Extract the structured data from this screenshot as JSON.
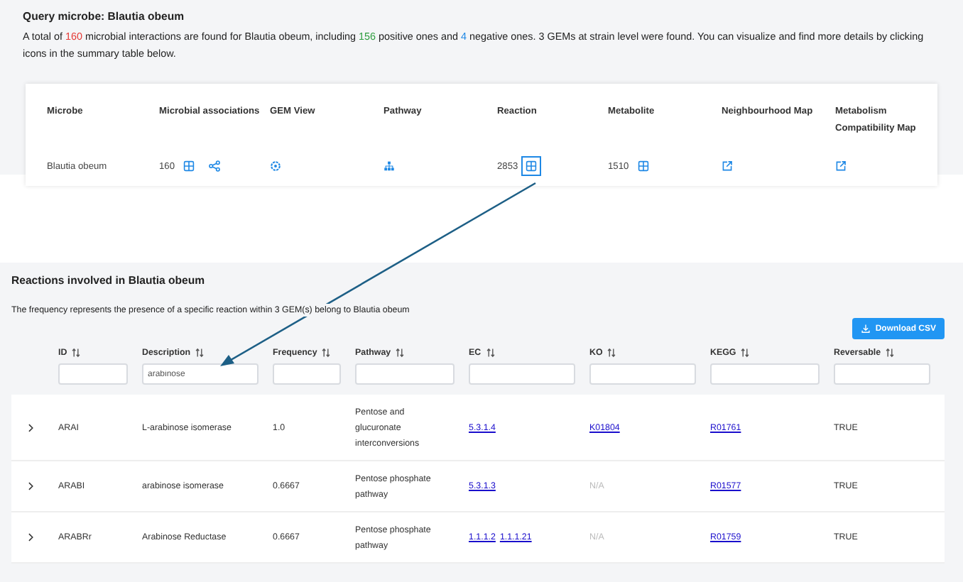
{
  "query": {
    "title": "Query microbe: Blautia obeum",
    "summary": [
      {
        "kind": "text",
        "text": "A total of "
      },
      {
        "kind": "total",
        "text": "160"
      },
      {
        "kind": "text",
        "text": " microbial interactions are found for Blautia obeum, including "
      },
      {
        "kind": "positive",
        "text": "156"
      },
      {
        "kind": "text",
        "text": " positive ones and "
      },
      {
        "kind": "negative",
        "text": "4"
      },
      {
        "kind": "text",
        "text": " negative ones. 3 GEMs at strain level were found. You can visualize and find more details by clicking icons in the summary table below."
      }
    ]
  },
  "summary_table": {
    "columns": [
      "Microbe",
      "Microbial associations",
      "GEM View",
      "Pathway",
      "Reaction",
      "Metabolite",
      "Neighbourhood Map",
      "Metabolism Compatibility Map"
    ],
    "row": {
      "microbe": "Blautia obeum",
      "associations": "160",
      "reaction": "2853",
      "reaction_highlighted": true,
      "metabolite": "1510"
    }
  },
  "reactions": {
    "title": "Reactions involved in Blautia obeum",
    "note": "The frequency represents the presence of a specific reaction within 3 GEM(s) belong to Blautia obeum",
    "download_button": "Download CSV",
    "columns": [
      {
        "label": "ID"
      },
      {
        "label": "Description",
        "filter": "arabinose"
      },
      {
        "label": "Frequency"
      },
      {
        "label": "Pathway"
      },
      {
        "label": "EC"
      },
      {
        "label": "KO"
      },
      {
        "label": "KEGG"
      },
      {
        "label": "Reversable"
      }
    ],
    "rows": [
      {
        "id": "ARAI",
        "description": "L-arabinose isomerase",
        "frequency": "1.0",
        "pathway": "Pentose and glucuronate interconversions",
        "ec": [
          "5.3.1.4"
        ],
        "ko": {
          "text": "K01804",
          "linked": true
        },
        "kegg": "R01761",
        "reversable": "TRUE"
      },
      {
        "id": "ARABI",
        "description": "arabinose isomerase",
        "frequency": "0.6667",
        "pathway": "Pentose phosphate pathway",
        "ec": [
          "5.3.1.3"
        ],
        "ko": {
          "text": "N/A",
          "linked": false
        },
        "kegg": "R01577",
        "reversable": "TRUE"
      },
      {
        "id": "ARABRr",
        "description": "Arabinose Reductase",
        "frequency": "0.6667",
        "pathway": "Pentose phosphate pathway",
        "ec": [
          "1.1.1.2",
          "1.1.1.21"
        ],
        "ko": {
          "text": "N/A",
          "linked": false
        },
        "kegg": "R01759",
        "reversable": "TRUE"
      }
    ]
  }
}
